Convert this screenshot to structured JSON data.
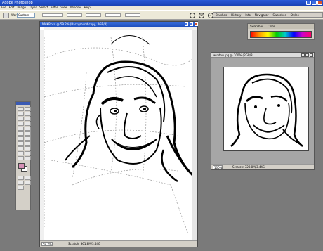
{
  "app": {
    "title": "Adobe Photoshop"
  },
  "menu": [
    "File",
    "Edit",
    "Image",
    "Layer",
    "Select",
    "Filter",
    "View",
    "Window",
    "Help"
  ],
  "options": {
    "warp_label": "Warp:",
    "warp_value": "Custom"
  },
  "palette_well": [
    "Brushes",
    "History",
    "Info",
    "Navigator",
    "Swatches",
    "Styles"
  ],
  "color_panel": {
    "tabs": [
      "Swatches",
      "Color"
    ]
  },
  "document": {
    "title": "NMKP.psd @ 59.2% (Background copy, RGB/8)",
    "zoom": "59.2%",
    "status": "Scratch: 361.8M/3.44G"
  },
  "preview": {
    "title": "window.jpg @ 100% (RGB/8)",
    "zoom": "100%",
    "status": "Scratch: 320.8M/3.44G"
  },
  "colors": {
    "titlebar": "#2a5bd7",
    "foreground": "#d58fb4",
    "background": "#ffffff",
    "workspace": "#7a7a7a"
  }
}
